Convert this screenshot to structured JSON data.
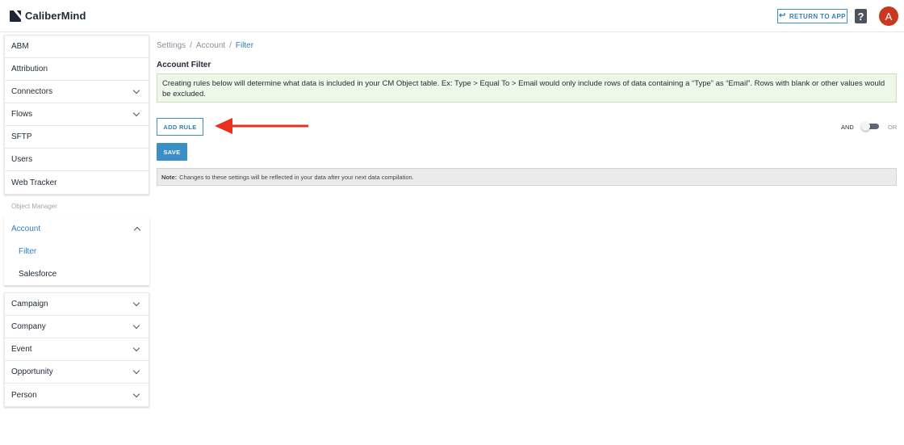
{
  "app": {
    "brand_name": "CaliberMind",
    "return_label": "RETURN TO APP",
    "return_icon": "arrow-left-icon",
    "help_glyph": "?",
    "avatar_initial": "A",
    "accent_color": "#2f80c0",
    "avatar_color": "#c8391f"
  },
  "sidebar": {
    "top_items": [
      {
        "label": "ABM",
        "chevron": false
      },
      {
        "label": "Attribution",
        "chevron": false
      },
      {
        "label": "Connectors",
        "chevron": true
      },
      {
        "label": "Flows",
        "chevron": true
      },
      {
        "label": "SFTP",
        "chevron": false
      },
      {
        "label": "Users",
        "chevron": false
      },
      {
        "label": "Web Tracker",
        "chevron": false
      }
    ],
    "section_label": "Object Manager",
    "account": {
      "label": "Account",
      "expanded": true,
      "sub_items": [
        "Filter",
        "Salesforce"
      ]
    },
    "object_items": [
      {
        "label": "Campaign"
      },
      {
        "label": "Company"
      },
      {
        "label": "Event"
      },
      {
        "label": "Opportunity"
      },
      {
        "label": "Person"
      }
    ]
  },
  "main": {
    "breadcrumb": [
      "Settings",
      "Account",
      "Filter"
    ],
    "breadcrumb_sep": "/",
    "title": "Account Filter",
    "info_text": "Creating rules below will determine what data is included in your CM Object table. Ex: Type > Equal To > Email would only include rows of data containing a “Type” as “Email”. Rows with blank or other values would be excluded.",
    "add_rule_label": "ADD RULE",
    "toggle": {
      "left_label": "AND",
      "right_label": "OR",
      "value": "AND"
    },
    "save_label": "SAVE",
    "note_label": "Note:",
    "note_text": "Changes to these settings will be reflected in your data after your next data compilation.",
    "annotation_color": "#e8321f"
  }
}
